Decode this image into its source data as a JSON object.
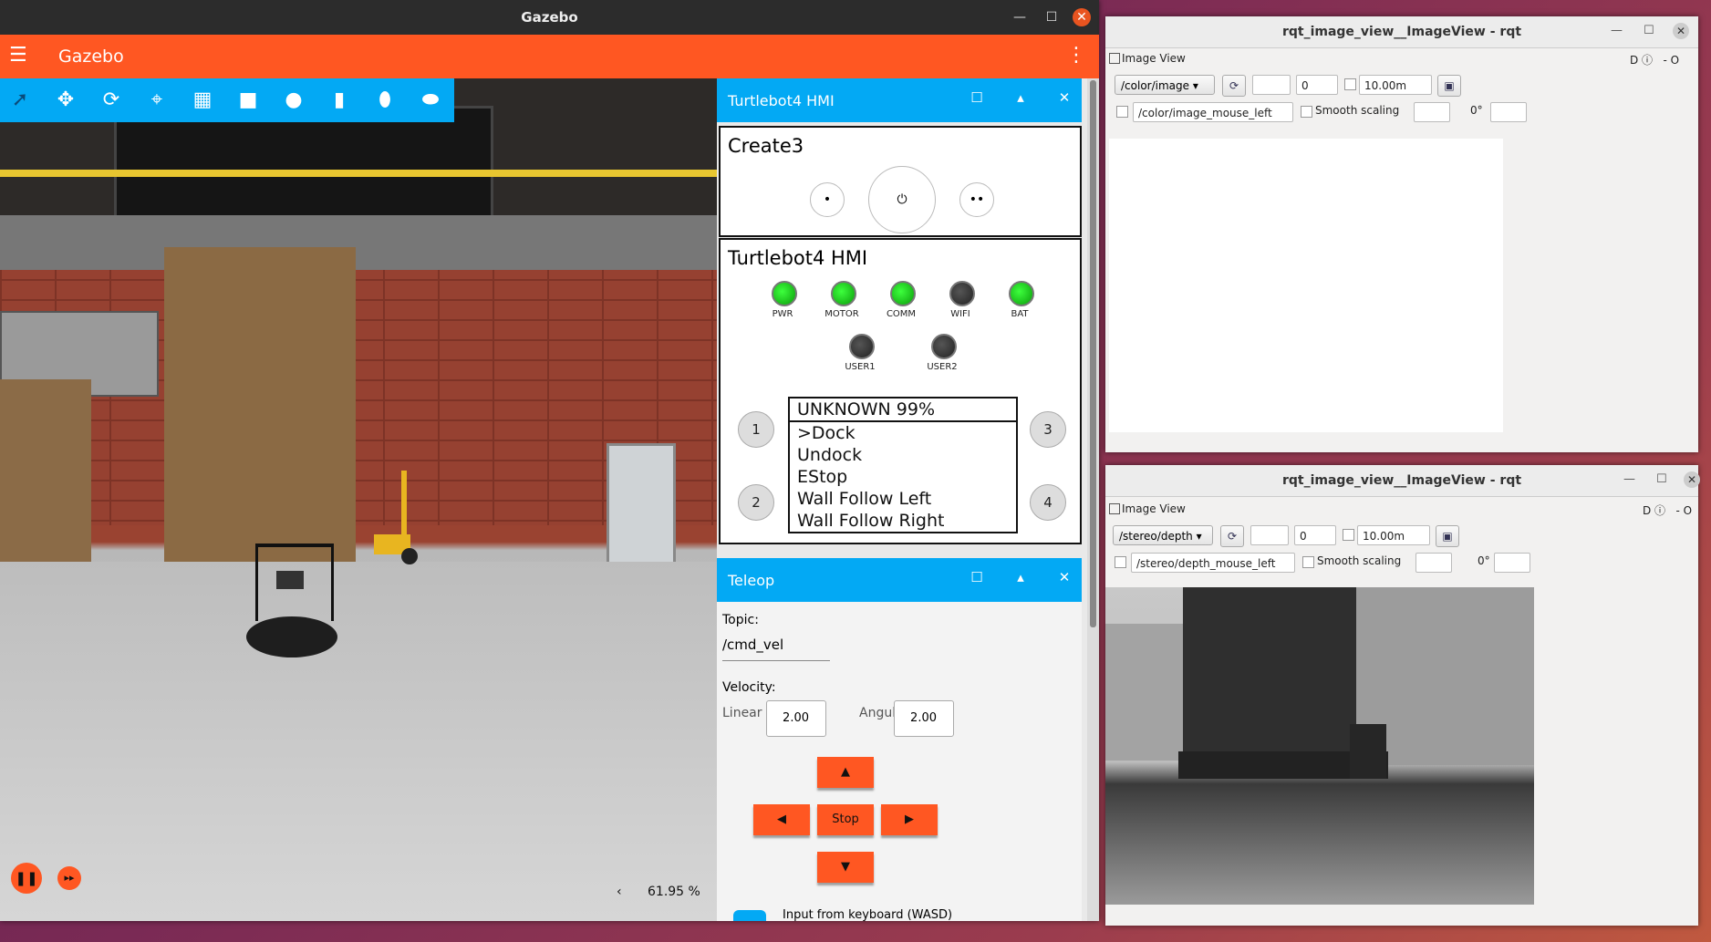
{
  "gazebo": {
    "window_title": "Gazebo",
    "app_title": "Gazebo",
    "zoom": "61.95 %",
    "hmi_panel": {
      "title": "Turtlebot4 HMI",
      "create3_title": "Create3",
      "hmi_title": "Turtlebot4 HMI",
      "leds": [
        "PWR",
        "MOTOR",
        "COMM",
        "WIFI",
        "BAT"
      ],
      "user_leds": [
        "USER1",
        "USER2"
      ],
      "buttons": [
        "1",
        "2",
        "3",
        "4"
      ],
      "display_lines": [
        "UNKNOWN 99%",
        ">Dock",
        "Undock",
        "EStop",
        "Wall Follow Left",
        "Wall Follow Right"
      ]
    },
    "teleop": {
      "title": "Teleop",
      "topic_label": "Topic:",
      "topic_value": "/cmd_vel",
      "velocity_label": "Velocity:",
      "linear_label": "Linear",
      "linear_value": "2.00",
      "angular_label": "Angular",
      "angular_value": "2.00",
      "stop_label": "Stop",
      "keyboard_label": "Input from keyboard (WASD)"
    }
  },
  "rqt_top": {
    "window_title": "rqt_image_view__ImageView - rqt",
    "plugin_title": "Image View",
    "topic": "/color/image",
    "spin_value": "0",
    "range_value": "10.00m",
    "mouse_topic": "/color/image_mouse_left",
    "smooth_label": "Smooth scaling",
    "rotation": "0°"
  },
  "rqt_bottom": {
    "window_title": "rqt_image_view__ImageView - rqt",
    "plugin_title": "Image View",
    "topic": "/stereo/depth",
    "spin_value": "0",
    "range_value": "10.00m",
    "mouse_topic": "/stereo/depth_mouse_left",
    "smooth_label": "Smooth scaling",
    "rotation": "0°"
  },
  "colors": {
    "gazebo_orange": "#ff5722",
    "panel_blue": "#03a9f4",
    "led_green": "#1db31d"
  }
}
